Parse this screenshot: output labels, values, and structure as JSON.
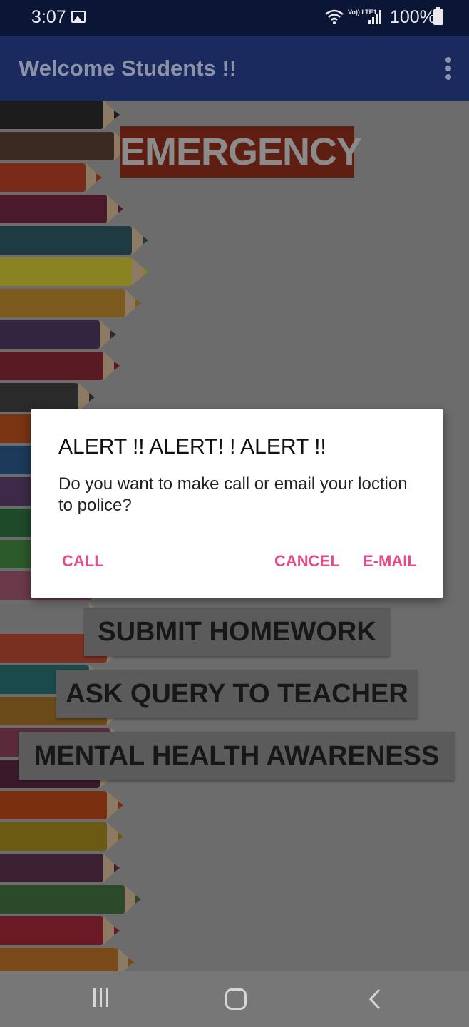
{
  "status_bar": {
    "time": "3:07",
    "network_label": "Vo)) LTE1",
    "battery": "100%"
  },
  "app_bar": {
    "title": "Welcome Students !!"
  },
  "content": {
    "banner": "EMERGENCY",
    "buttons": [
      {
        "label": "SUBMIT HOMEWORK"
      },
      {
        "label": "ASK QUERY TO TEACHER"
      },
      {
        "label": "MENTAL HEALTH AWARENESS"
      }
    ]
  },
  "dialog": {
    "title": "ALERT !! ALERT! ! ALERT !!",
    "message": "Do you want to make call or email your loction to police?",
    "buttons": {
      "call": "CALL",
      "cancel": "CANCEL",
      "email": "E-MAIL"
    },
    "accent_color": "#e54a8c"
  },
  "colors": {
    "status_bar": "#0b1536",
    "app_bar": "#1a2a5e",
    "banner": "#c8321c"
  }
}
